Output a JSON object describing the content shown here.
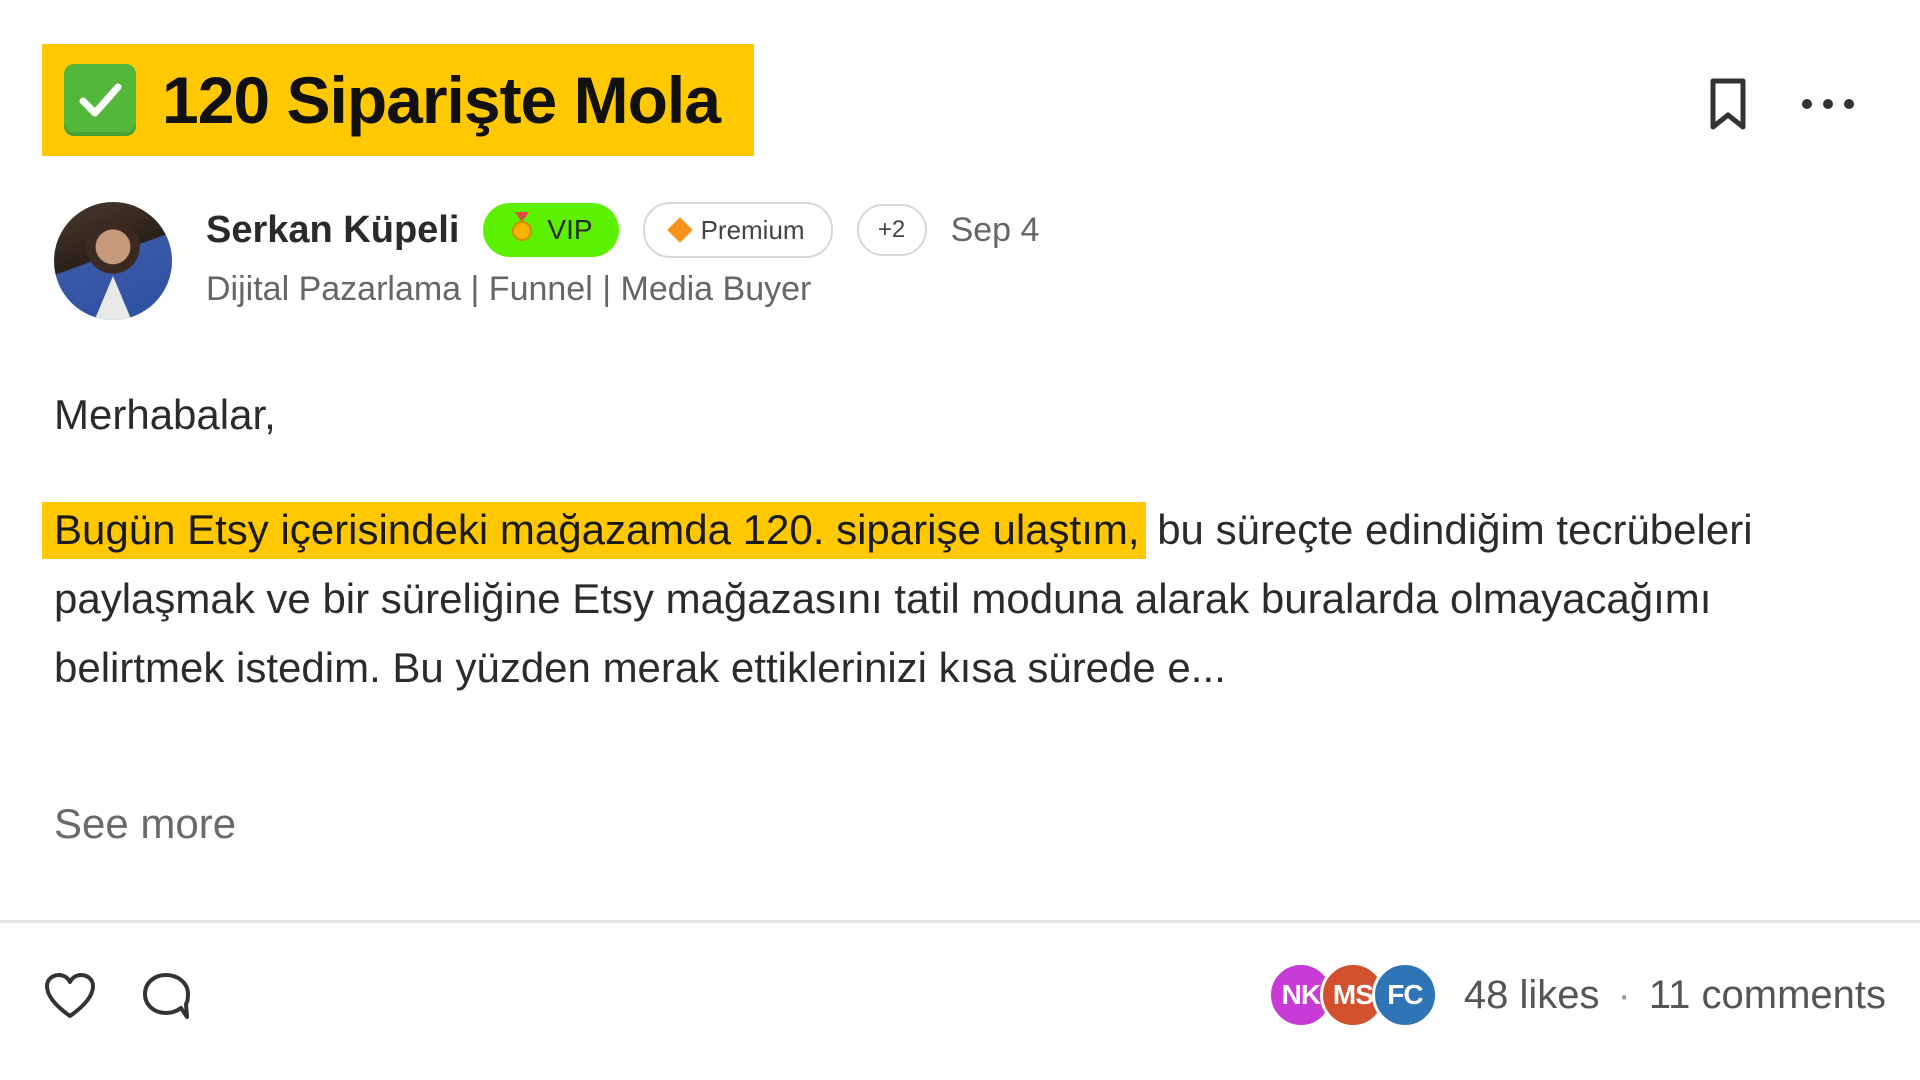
{
  "post": {
    "title": "120 Siparişte Mola",
    "title_icon": "check-mark-button-icon",
    "actions": {
      "bookmark_icon": "bookmark-icon",
      "more_icon": "more-horizontal-icon"
    }
  },
  "author": {
    "name": "Serkan Küpeli",
    "bio": "Dijital Pazarlama | Funnel | Media Buyer",
    "badges": {
      "vip": "VIP",
      "premium": "Premium",
      "more": "+2"
    },
    "date": "Sep 4"
  },
  "body": {
    "greeting": "Merhabalar,",
    "highlight": "Bugün Etsy içerisindeki mağazamda 120. siparişe ulaştım,",
    "rest": " bu süreçte edindiğim tecrübeleri paylaşmak ve bir süreliğine Etsy mağazasını tatil moduna alarak buralarda olmayacağımı belirtmek istedim. Bu yüzden merak ettiklerinizi kısa sürede e...",
    "see_more": "See more"
  },
  "footer": {
    "liker_avatars": [
      {
        "initials": "NK",
        "color": "#c93bd6"
      },
      {
        "initials": "MS",
        "color": "#d3502e"
      },
      {
        "initials": "FC",
        "color": "#2f74b5"
      }
    ],
    "likes": "48 likes",
    "separator": "·",
    "comments": "11 comments"
  },
  "colors": {
    "highlight": "#ffc800",
    "vip_badge": "#5cf100",
    "check": "#53b73a"
  }
}
